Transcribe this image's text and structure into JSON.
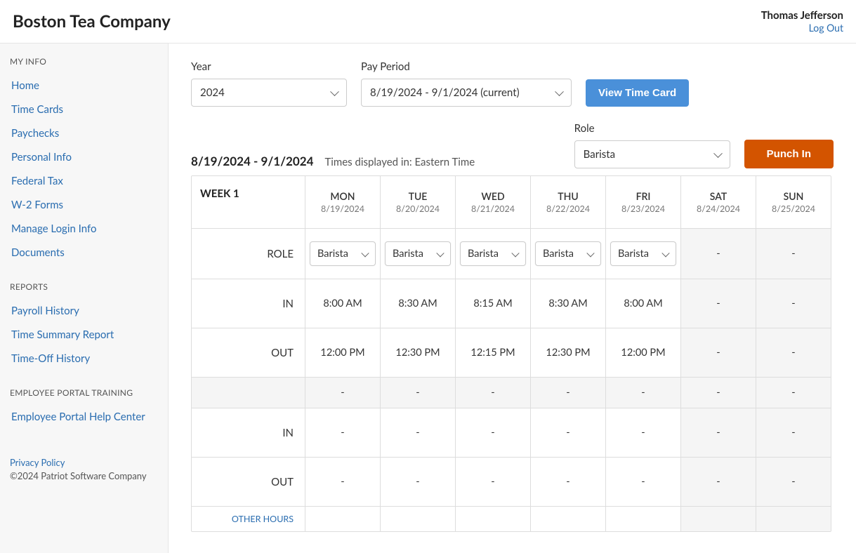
{
  "header": {
    "company": "Boston Tea Company",
    "user": "Thomas Jefferson",
    "logout": "Log Out"
  },
  "sidebar": {
    "sections": [
      {
        "title": "MY INFO",
        "items": [
          "Home",
          "Time Cards",
          "Paychecks",
          "Personal Info",
          "Federal Tax",
          "W-2 Forms",
          "Manage Login Info",
          "Documents"
        ]
      },
      {
        "title": "REPORTS",
        "items": [
          "Payroll History",
          "Time Summary Report",
          "Time-Off History"
        ]
      },
      {
        "title": "EMPLOYEE PORTAL TRAINING",
        "items": [
          "Employee Portal Help Center"
        ]
      }
    ],
    "privacy": "Privacy Policy",
    "copyright": "©2024 Patriot Software Company"
  },
  "filters": {
    "year_label": "Year",
    "year_value": "2024",
    "period_label": "Pay Period",
    "period_value": "8/19/2024 - 9/1/2024 (current)",
    "view_btn": "View Time Card",
    "role_label": "Role",
    "role_value": "Barista",
    "punch_btn": "Punch In"
  },
  "meta": {
    "range": "8/19/2024 - 9/1/2024",
    "tz": "Times displayed in: Eastern Time"
  },
  "timecard": {
    "week_label": "WEEK 1",
    "days": [
      {
        "abbr": "MON",
        "date": "8/19/2024",
        "empty": false
      },
      {
        "abbr": "TUE",
        "date": "8/20/2024",
        "empty": false
      },
      {
        "abbr": "WED",
        "date": "8/21/2024",
        "empty": false
      },
      {
        "abbr": "THU",
        "date": "8/22/2024",
        "empty": false
      },
      {
        "abbr": "FRI",
        "date": "8/23/2024",
        "empty": false
      },
      {
        "abbr": "SAT",
        "date": "8/24/2024",
        "empty": true
      },
      {
        "abbr": "SUN",
        "date": "8/25/2024",
        "empty": true
      }
    ],
    "rows": [
      {
        "label": "ROLE",
        "type": "role",
        "cells": [
          "Barista",
          "Barista",
          "Barista",
          "Barista",
          "Barista",
          "-",
          "-"
        ]
      },
      {
        "label": "IN",
        "type": "text",
        "cells": [
          "8:00 AM",
          "8:30 AM",
          "8:15 AM",
          "8:30 AM",
          "8:00 AM",
          "-",
          "-"
        ]
      },
      {
        "label": "OUT",
        "type": "text",
        "cells": [
          "12:00 PM",
          "12:30 PM",
          "12:15 PM",
          "12:30 PM",
          "12:00 PM",
          "-",
          "-"
        ]
      },
      {
        "label": "",
        "type": "gray",
        "cells": [
          "-",
          "-",
          "-",
          "-",
          "-",
          "-",
          "-"
        ]
      },
      {
        "label": "IN",
        "type": "text",
        "cells": [
          "-",
          "-",
          "-",
          "-",
          "-",
          "-",
          "-"
        ]
      },
      {
        "label": "OUT",
        "type": "text",
        "cells": [
          "-",
          "-",
          "-",
          "-",
          "-",
          "-",
          "-"
        ]
      }
    ],
    "other_hours": "OTHER HOURS"
  }
}
